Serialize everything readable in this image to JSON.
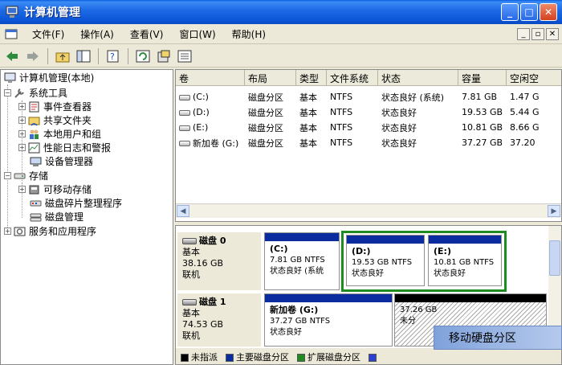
{
  "window": {
    "title": "计算机管理"
  },
  "menu": [
    "文件(F)",
    "操作(A)",
    "查看(V)",
    "窗口(W)",
    "帮助(H)"
  ],
  "tree": {
    "root": "计算机管理(本地)",
    "system_tools": "系统工具",
    "event_viewer": "事件查看器",
    "shared_folders": "共享文件夹",
    "local_users": "本地用户和组",
    "perf_logs": "性能日志和警报",
    "device_manager": "设备管理器",
    "storage": "存储",
    "removable": "可移动存储",
    "defrag": "磁盘碎片整理程序",
    "disk_mgmt": "磁盘管理",
    "services": "服务和应用程序"
  },
  "list": {
    "columns": [
      "卷",
      "布局",
      "类型",
      "文件系统",
      "状态",
      "容量",
      "空闲空"
    ],
    "rows": [
      [
        "(C:)",
        "磁盘分区",
        "基本",
        "NTFS",
        "状态良好 (系统)",
        "7.81 GB",
        "1.47 G"
      ],
      [
        "(D:)",
        "磁盘分区",
        "基本",
        "NTFS",
        "状态良好",
        "19.53 GB",
        "5.44 G"
      ],
      [
        "(E:)",
        "磁盘分区",
        "基本",
        "NTFS",
        "状态良好",
        "10.81 GB",
        "8.66 G"
      ],
      [
        "新加卷 (G:)",
        "磁盘分区",
        "基本",
        "NTFS",
        "状态良好",
        "37.27 GB",
        "37.20"
      ]
    ]
  },
  "disks": [
    {
      "name": "磁盘 0",
      "type": "基本",
      "size": "38.16 GB",
      "status": "联机",
      "parts": [
        {
          "name": "(C:)",
          "info": "7.81 GB NTFS",
          "state": "状态良好 (系统"
        },
        {
          "name": "(D:)",
          "info": "19.53 GB NTFS",
          "state": "状态良好"
        },
        {
          "name": "(E:)",
          "info": "10.81 GB NTFS",
          "state": "状态良好"
        }
      ]
    },
    {
      "name": "磁盘 1",
      "type": "基本",
      "size": "74.53 GB",
      "status": "联机",
      "parts": [
        {
          "name": "新加卷 (G:)",
          "info": "37.27 GB NTFS",
          "state": "状态良好"
        },
        {
          "name": "",
          "info": "37.26 GB",
          "state": "未分"
        }
      ]
    }
  ],
  "legend": [
    "未指派",
    "主要磁盘分区",
    "扩展磁盘分区"
  ],
  "legend_colors": [
    "#000000",
    "#0A2C9E",
    "#1E8C21",
    "#2B3FD0"
  ],
  "popup": {
    "label": "移动硬盘分区"
  }
}
